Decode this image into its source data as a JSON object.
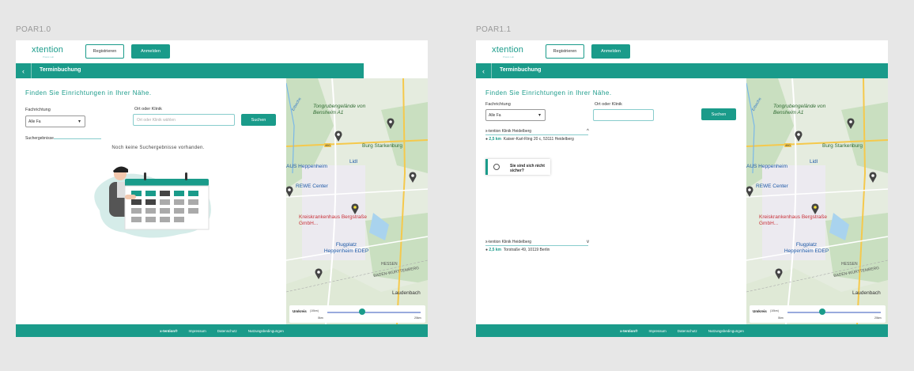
{
  "frames": [
    {
      "label": "POAR1.0",
      "logo": "xtention",
      "logo_sub": "Praxis Lab",
      "register_label": "Registrieren",
      "login_label": "Anmelden",
      "back_icon": "chevron-left-icon",
      "bar_title": "Terminbuchung",
      "heading": "Finden Sie Einrichtungen in Ihrer Nähe.",
      "field1_label": "Fachrichtung",
      "field1_value": "Alle Fa",
      "field2_label": "Ort oder Klinik",
      "field2_placeholder": "Ort oder Klinik wählen",
      "search_label": "Suchen",
      "results_label": "Suchergebnisse",
      "empty_text": "Noch keine Suchergebnisse vorhanden.",
      "slider_label": "Umkreis",
      "slider_value": "(10km)",
      "slider_min": "0km",
      "slider_max": "20km",
      "footer": [
        "x-tention®",
        "Impressum",
        "Datenschutz",
        "Nutzungsbedingungen"
      ]
    },
    {
      "label": "POAR1.1",
      "logo": "xtention",
      "logo_sub": "Praxis Lab",
      "register_label": "Registrieren",
      "login_label": "Anmelden",
      "back_icon": "chevron-left-icon",
      "bar_title": "Terminbuchung",
      "heading": "Finden Sie Einrichtungen in Ihrer Nähe.",
      "field1_label": "Fachrichtung",
      "field1_value": "Alle Fa",
      "field2_label": "Ort oder Klinik",
      "field2_placeholder": "",
      "search_label": "Suchen",
      "results": [
        {
          "name": "x-tention Klinik Heidelberg",
          "distance": "2,5 km",
          "address": "Kaiser-Karl-Ring 20 c, 53111 Heidelberg",
          "chevron": "^"
        },
        {
          "name": "x-tention Klinik Heidelberg",
          "distance": "2,5 km",
          "address": "Torstraße 49, 10119 Berlin",
          "chevron": "v"
        }
      ],
      "help_text": "Sie sind sich nicht sicher?",
      "slider_label": "Umkreis",
      "slider_value": "(10km)",
      "slider_min": "0km",
      "slider_max": "20km",
      "footer": [
        "x-tention®",
        "Impressum",
        "Datenschutz",
        "Nutzungsbedingungen"
      ]
    }
  ],
  "map": {
    "labels": [
      "Tongrubengelände von Bensheim A1",
      "Burg Starkenburg",
      "Lidl",
      "AUS Heppenheim",
      "REWE Center",
      "Kreiskrankenhaus Bergstraße GmbH...",
      "Flugplatz Heppenheim EDEP",
      "HESSEN",
      "BADEN-WÜRTTEMBERG",
      "Laudenbach",
      "Erbache",
      "460"
    ]
  },
  "colors": {
    "primary": "#1a9b8a"
  }
}
